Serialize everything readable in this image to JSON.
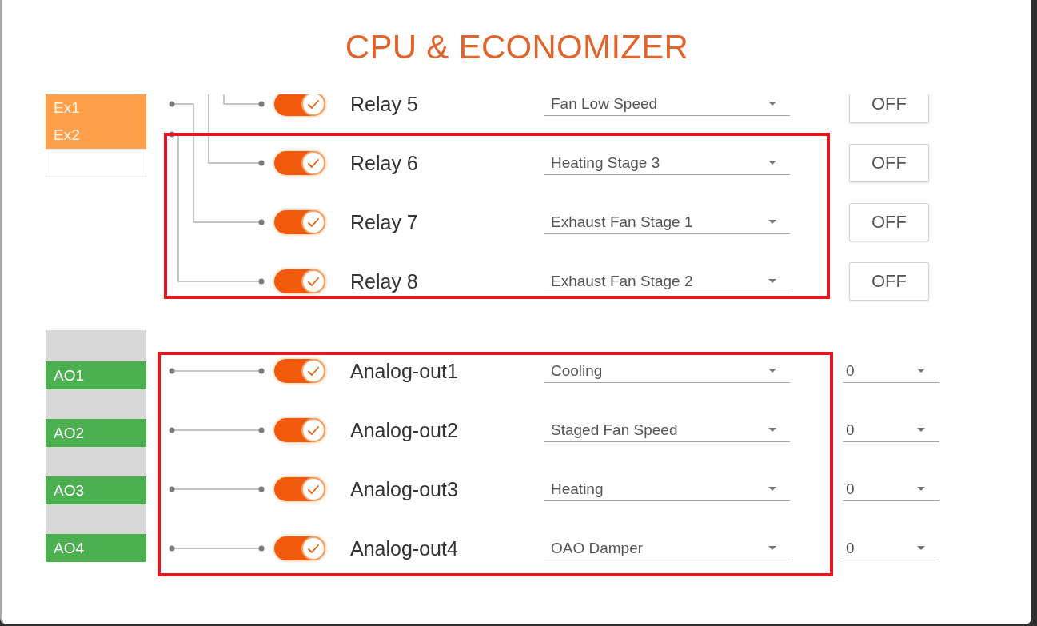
{
  "title": "CPU & ECONOMIZER",
  "relay_ports": [
    "Ex1",
    "Ex2"
  ],
  "relays": [
    {
      "name": "Relay 5",
      "on": true,
      "function": "Fan Low Speed",
      "button": "OFF",
      "highlighted": false
    },
    {
      "name": "Relay 6",
      "on": true,
      "function": "Heating Stage 3",
      "button": "OFF",
      "highlighted": true
    },
    {
      "name": "Relay 7",
      "on": true,
      "function": "Exhaust Fan Stage 1",
      "button": "OFF",
      "highlighted": true
    },
    {
      "name": "Relay 8",
      "on": true,
      "function": "Exhaust Fan Stage 2",
      "button": "OFF",
      "highlighted": true
    }
  ],
  "analog_ports": [
    "AO1",
    "AO2",
    "AO3",
    "AO4"
  ],
  "analog_outputs": [
    {
      "name": "Analog-out1",
      "on": true,
      "function": "Cooling",
      "value": "0",
      "highlighted": true
    },
    {
      "name": "Analog-out2",
      "on": true,
      "function": "Staged Fan Speed",
      "value": "0",
      "highlighted": true
    },
    {
      "name": "Analog-out3",
      "on": true,
      "function": "Heating",
      "value": "0",
      "highlighted": true
    },
    {
      "name": "Analog-out4",
      "on": true,
      "function": "OAO Damper",
      "value": "0",
      "highlighted": true
    }
  ]
}
